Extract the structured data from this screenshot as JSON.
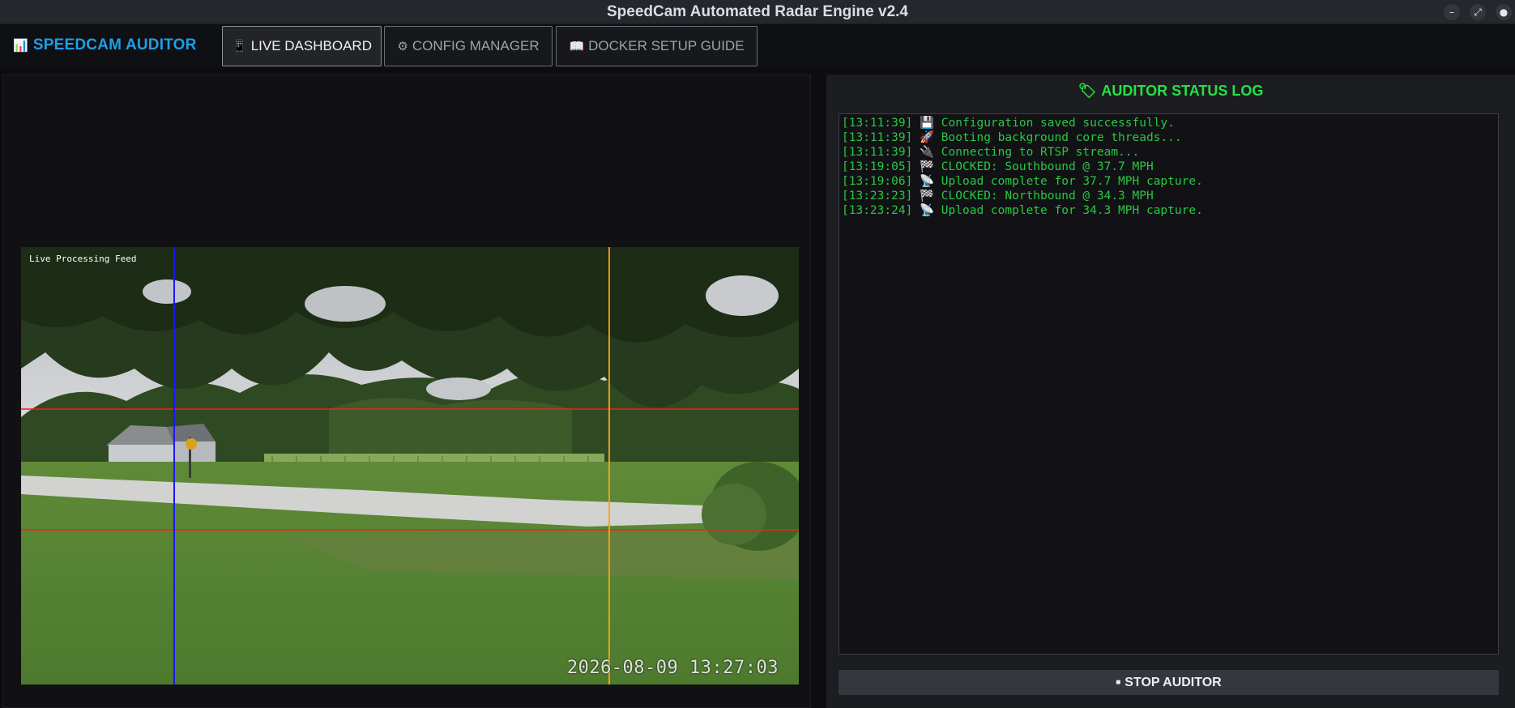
{
  "window": {
    "title": "SpeedCam Automated Radar Engine v2.4",
    "minimize_glyph": "–",
    "maximize_glyph": "⤢",
    "close_glyph": "●"
  },
  "nav": {
    "brand_icon": "📊",
    "brand": "SPEEDCAM AUDITOR",
    "tabs": [
      {
        "icon": "📱",
        "label": "LIVE DASHBOARD",
        "active": true
      },
      {
        "icon": "⚙",
        "label": "CONFIG MANAGER",
        "active": false
      },
      {
        "icon": "📖",
        "label": "DOCKER SETUP GUIDE",
        "active": false
      }
    ]
  },
  "feed": {
    "label": "Live Processing Feed",
    "timestamp": "2026-08-09 13:27:03",
    "line_colors": {
      "horizontal": "#ff1a1a",
      "left_vertical": "#1818ff",
      "right_vertical": "#ffa010"
    }
  },
  "log": {
    "title_icon": "🏷",
    "title": "AUDITOR STATUS LOG",
    "lines": [
      "[13:11:39] 💾 Configuration saved successfully.",
      "[13:11:39] 🚀 Booting background core threads...",
      "[13:11:39] 🔌 Connecting to RTSP stream...",
      "[13:19:05] 🏁 CLOCKED: Southbound @ 37.7 MPH",
      "[13:19:06] 📡 Upload complete for 37.7 MPH capture.",
      "[13:23:23] 🏁 CLOCKED: Northbound @ 34.3 MPH",
      "[13:23:24] 📡 Upload complete for 34.3 MPH capture."
    ]
  },
  "controls": {
    "stop_icon": "■",
    "stop_label": "STOP AUDITOR"
  },
  "colors": {
    "accent_blue": "#1e9fe3",
    "log_green": "#27c940",
    "title_green": "#27e045"
  }
}
